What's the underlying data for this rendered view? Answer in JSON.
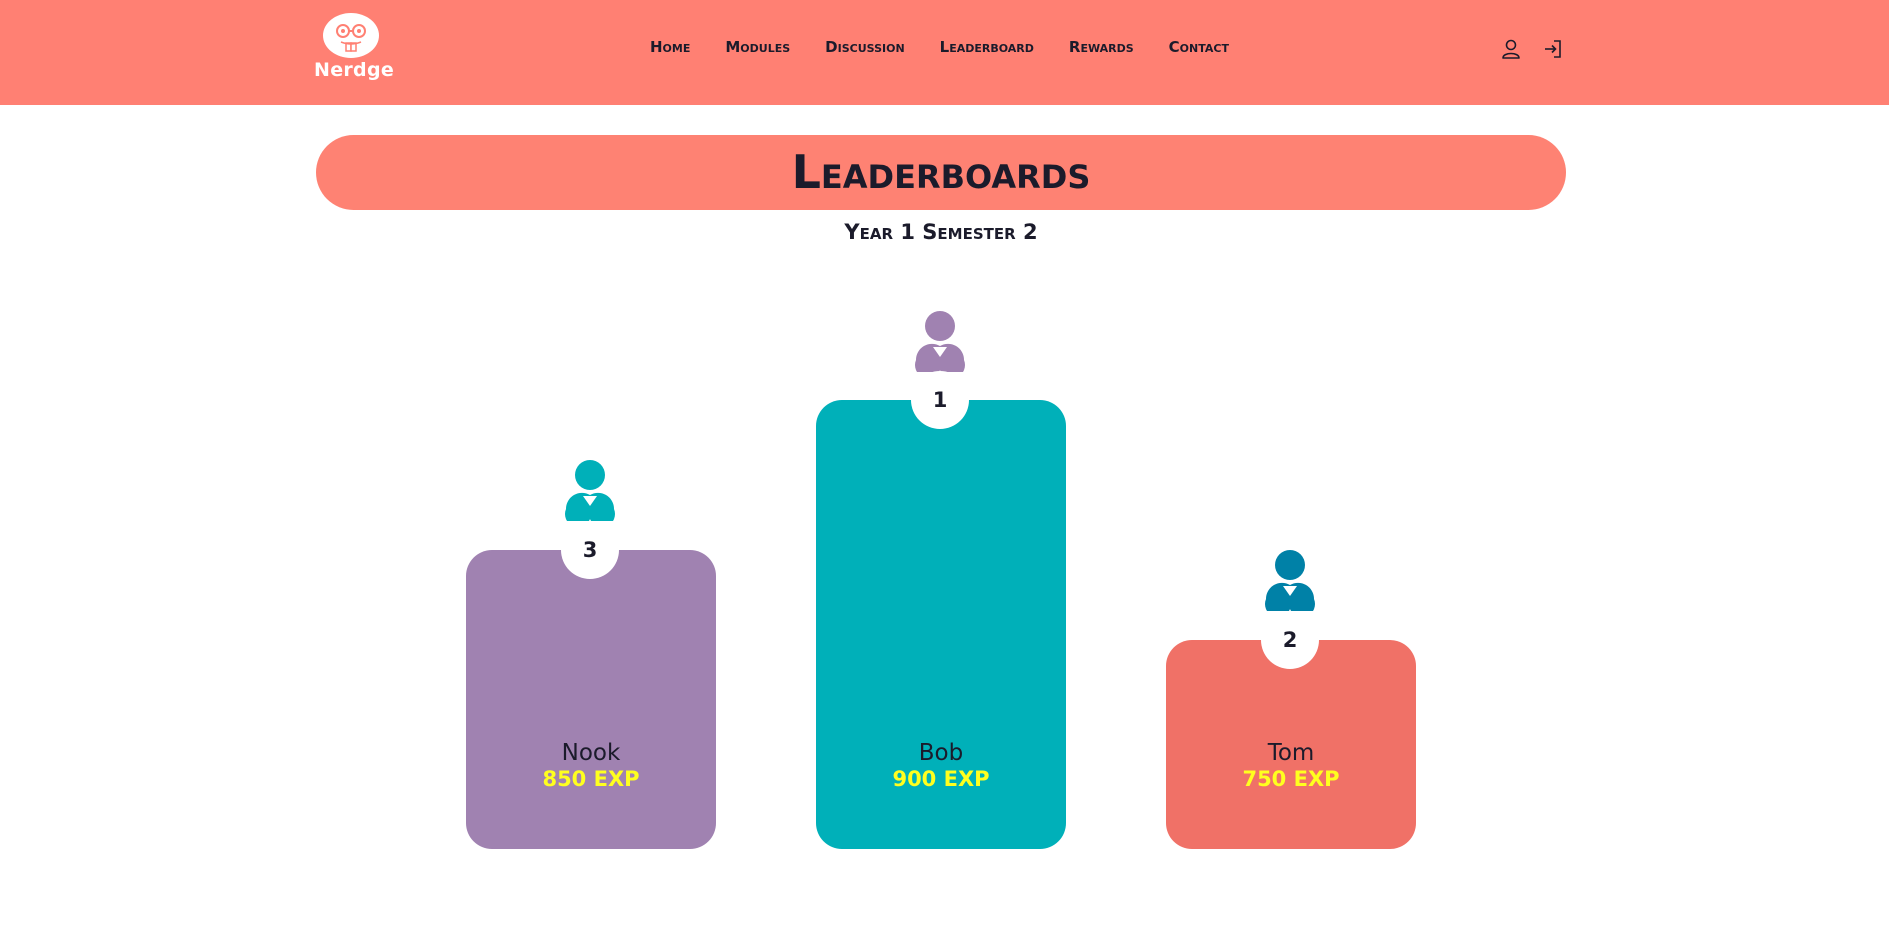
{
  "brand": {
    "name": "Nerdge"
  },
  "nav": {
    "items": [
      {
        "label": "Home"
      },
      {
        "label": "Modules"
      },
      {
        "label": "Discussion"
      },
      {
        "label": "Leaderboard"
      },
      {
        "label": "Rewards"
      },
      {
        "label": "Contact"
      }
    ],
    "icons": [
      "user-icon",
      "login-icon"
    ]
  },
  "page": {
    "title": "Leaderboards",
    "subtitle": "Year 1 Semester 2"
  },
  "podium": [
    {
      "rank": "3",
      "name": "Nook",
      "exp": "850 EXP",
      "color": "#a082b1",
      "avatar_color": "#00b0b9"
    },
    {
      "rank": "1",
      "name": "Bob",
      "exp": "900 EXP",
      "color": "#00b0b9",
      "avatar_color": "#a082b1"
    },
    {
      "rank": "2",
      "name": "Tom",
      "exp": "750 EXP",
      "color": "#f07167",
      "avatar_color": "#0081a7"
    }
  ],
  "colors": {
    "header": "#ff8073",
    "title_pill": "#fe8273",
    "exp_text": "#ffff1f"
  }
}
